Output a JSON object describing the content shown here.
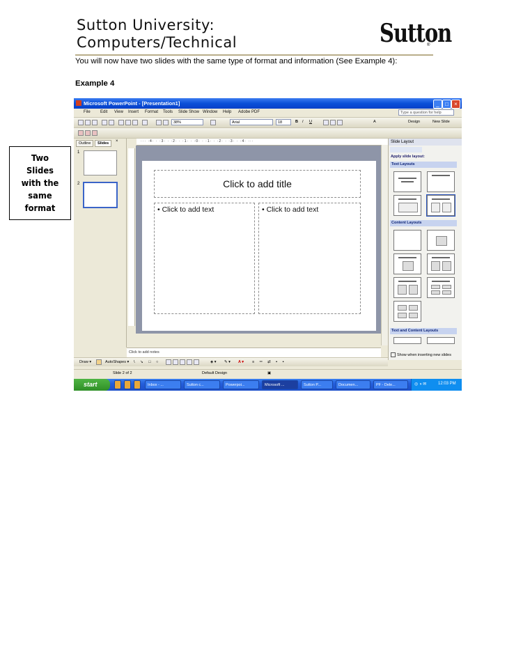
{
  "header": {
    "title_line1": "Sutton University:",
    "title_line2": "Computers/Technical",
    "logo_text": "Sutton",
    "logo_reg": "®"
  },
  "intro": "You will now have two slides with the same type of format and information (See Example 4):",
  "example_label": "Example 4",
  "callout": "Two\nSlides\nwith the\nsame\nformat",
  "screenshot": {
    "window_title": "Microsoft PowerPoint - [Presentation1]",
    "menu": [
      "File",
      "Edit",
      "View",
      "Insert",
      "Format",
      "Tools",
      "Slide Show",
      "Window",
      "Help",
      "Adobe PDF"
    ],
    "help_placeholder": "Type a question for help",
    "zoom": "38%",
    "font": "Arial",
    "font_size": "18",
    "design_label": "Design",
    "new_slide_label": "New Slide",
    "tabs": {
      "outline": "Outline",
      "slides": "Slides"
    },
    "slide_numbers": [
      "1",
      "2"
    ],
    "slide": {
      "title_placeholder": "Click to add title",
      "left_text": "• Click to add text",
      "right_text": "• Click to add text"
    },
    "notes_placeholder": "Click to add notes",
    "task_pane": {
      "header": "Slide Layout",
      "apply_label": "Apply slide layout:",
      "text_layouts": "Text Layouts",
      "content_layouts": "Content Layouts",
      "text_and_content": "Text and Content Layouts",
      "show_when": "Show when inserting new slides"
    },
    "draw": {
      "draw_label": "Draw ▾",
      "autoshapes_label": "AutoShapes ▾"
    },
    "status": {
      "slide_of": "Slide 2 of 2",
      "design": "Default Design"
    },
    "taskbar": {
      "start": "start",
      "items": [
        "Inbox - ...",
        "Sutton c...",
        "Powerpoi...",
        "Microsoft ...",
        "Sutton P...",
        "Documen...",
        "PF - Dele..."
      ],
      "clock": "12:03 PM"
    }
  }
}
